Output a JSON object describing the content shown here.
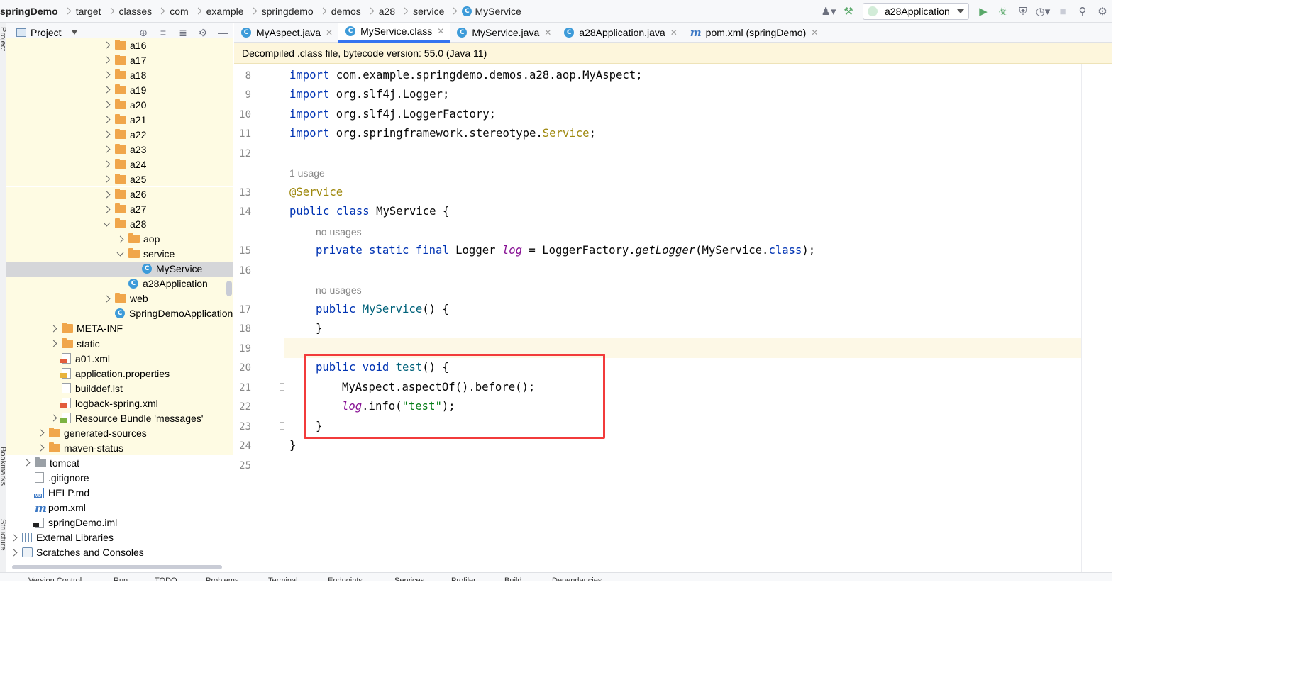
{
  "breadcrumb": [
    "springDemo",
    "target",
    "classes",
    "com",
    "example",
    "springdemo",
    "demos",
    "a28",
    "service",
    "MyService"
  ],
  "run_config": "a28Application",
  "project_panel": {
    "title": "Project",
    "tree": [
      {
        "label": "a16",
        "indent": 1,
        "type": "folder",
        "arrow": "r",
        "hl": true
      },
      {
        "label": "a17",
        "indent": 1,
        "type": "folder",
        "arrow": "r",
        "hl": true
      },
      {
        "label": "a18",
        "indent": 1,
        "type": "folder",
        "arrow": "r",
        "hl": true
      },
      {
        "label": "a19",
        "indent": 1,
        "type": "folder",
        "arrow": "r",
        "hl": true
      },
      {
        "label": "a20",
        "indent": 1,
        "type": "folder",
        "arrow": "r",
        "hl": true
      },
      {
        "label": "a21",
        "indent": 1,
        "type": "folder",
        "arrow": "r",
        "hl": true
      },
      {
        "label": "a22",
        "indent": 1,
        "type": "folder",
        "arrow": "r",
        "hl": true
      },
      {
        "label": "a23",
        "indent": 1,
        "type": "folder",
        "arrow": "r",
        "hl": true
      },
      {
        "label": "a24",
        "indent": 1,
        "type": "folder",
        "arrow": "r",
        "hl": true
      },
      {
        "label": "a25",
        "indent": 1,
        "type": "folder",
        "arrow": "r",
        "hl": true
      },
      {
        "label": "a26",
        "indent": 1,
        "type": "folder",
        "arrow": "r",
        "hl": true
      },
      {
        "label": "a27",
        "indent": 1,
        "type": "folder",
        "arrow": "r",
        "hl": true
      },
      {
        "label": "a28",
        "indent": 1,
        "type": "folder",
        "arrow": "d",
        "hl": true
      },
      {
        "label": "aop",
        "indent": 2,
        "type": "folder",
        "arrow": "r",
        "hl": true
      },
      {
        "label": "service",
        "indent": 2,
        "type": "folder",
        "arrow": "d",
        "hl": true
      },
      {
        "label": "MyService",
        "indent": 3,
        "type": "class",
        "arrow": "n",
        "sel": true
      },
      {
        "label": "a28Application",
        "indent": 2,
        "type": "class",
        "arrow": "n",
        "hl": true
      },
      {
        "label": "web",
        "indent": 1,
        "type": "folder",
        "arrow": "r",
        "hl": true
      },
      {
        "label": "SpringDemoApplication",
        "indent": 1,
        "type": "class",
        "arrow": "n",
        "hl": true
      },
      {
        "label": "META-INF",
        "indent": -1,
        "type": "folder",
        "arrow": "r",
        "hl": true
      },
      {
        "label": "static",
        "indent": -1,
        "type": "folder",
        "arrow": "r",
        "hl": true
      },
      {
        "label": "a01.xml",
        "indent": -1,
        "type": "xml",
        "arrow": "n",
        "hl": true
      },
      {
        "label": "application.properties",
        "indent": -1,
        "type": "prop",
        "arrow": "n",
        "hl": true
      },
      {
        "label": "builddef.lst",
        "indent": -1,
        "type": "file",
        "arrow": "n",
        "hl": true
      },
      {
        "label": "logback-spring.xml",
        "indent": -1,
        "type": "xml",
        "arrow": "n",
        "hl": true
      },
      {
        "label": "Resource Bundle 'messages'",
        "indent": -1,
        "type": "bundle",
        "arrow": "r",
        "hl": true
      },
      {
        "label": "generated-sources",
        "indent": -2,
        "type": "folder",
        "arrow": "r",
        "hl": true
      },
      {
        "label": "maven-status",
        "indent": -2,
        "type": "folder",
        "arrow": "r",
        "hl": true
      },
      {
        "label": "tomcat",
        "indent": -3,
        "type": "greyfolder",
        "arrow": "r",
        "hl": false
      },
      {
        "label": ".gitignore",
        "indent": -3,
        "type": "file",
        "arrow": "n",
        "hl": false
      },
      {
        "label": "HELP.md",
        "indent": -3,
        "type": "md",
        "arrow": "n",
        "hl": false
      },
      {
        "label": "pom.xml",
        "indent": -3,
        "type": "mvn",
        "arrow": "n",
        "hl": false
      },
      {
        "label": "springDemo.iml",
        "indent": -3,
        "type": "iml",
        "arrow": "n",
        "hl": false
      },
      {
        "label": "External Libraries",
        "indent": -4,
        "type": "lib",
        "arrow": "r",
        "hl": false
      },
      {
        "label": "Scratches and Consoles",
        "indent": -4,
        "type": "scr",
        "arrow": "r",
        "hl": false
      }
    ]
  },
  "tabs": [
    {
      "label": "MyAspect.java",
      "icon": "class",
      "active": false
    },
    {
      "label": "MyService.class",
      "icon": "class",
      "active": true
    },
    {
      "label": "MyService.java",
      "icon": "class",
      "active": false
    },
    {
      "label": "a28Application.java",
      "icon": "class",
      "active": false
    },
    {
      "label": "pom.xml (springDemo)",
      "icon": "maven",
      "active": false
    }
  ],
  "banner": "Decompiled .class file, bytecode version: 55.0 (Java 11)",
  "editor": {
    "line_numbers": [
      "8",
      "9",
      "10",
      "11",
      "12",
      "13",
      "14",
      "15",
      "16",
      "17",
      "18",
      "19",
      "20",
      "21",
      "22",
      "23",
      "24",
      "25"
    ],
    "hints": {
      "usage": "1 usage",
      "no_usages_1": "no usages",
      "no_usages_2": "no usages"
    },
    "code": {
      "l8": [
        "import",
        " com.example.springdemo.demos.a28.aop.MyAspect;"
      ],
      "l9": [
        "import",
        " org.slf4j.Logger;"
      ],
      "l10": [
        "import",
        " org.slf4j.LoggerFactory;"
      ],
      "l11": [
        "import",
        " org.springframework.stereotype.",
        "Service",
        ";"
      ],
      "l13": [
        "@Service"
      ],
      "l14": [
        "public class ",
        "MyService {"
      ],
      "l15": [
        "private static final ",
        "Logger ",
        "log",
        " = LoggerFactory.",
        "getLogger",
        "(MyService.",
        "class",
        ");"
      ],
      "l17": [
        "public ",
        "MyService",
        "() {"
      ],
      "l18": [
        "}"
      ],
      "l20": [
        "public void ",
        "test",
        "() {"
      ],
      "l21": [
        "MyAspect.aspectOf().before();"
      ],
      "l22": [
        "log",
        ".info(",
        "\"test\"",
        ");"
      ],
      "l23": [
        "}"
      ],
      "l24": [
        "}"
      ]
    }
  },
  "bottom_tools": [
    "Version Control",
    "Run",
    "TODO",
    "Problems",
    "Terminal",
    "Endpoints",
    "Services",
    "Profiler",
    "Build",
    "Dependencies"
  ],
  "side_tools": [
    "Project",
    "Bookmarks",
    "Structure"
  ]
}
